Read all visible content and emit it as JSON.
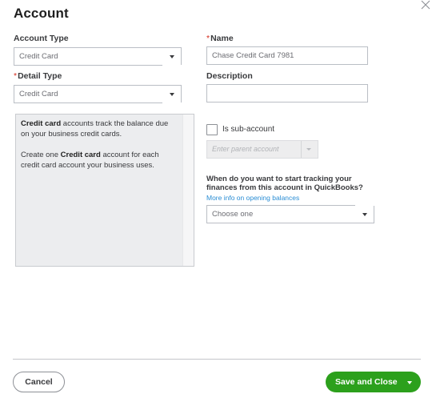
{
  "dialog": {
    "title": "Account",
    "close_icon": "close-icon"
  },
  "form": {
    "account_type": {
      "label": "Account Type",
      "value": "Credit Card"
    },
    "detail_type": {
      "required_marker": "*",
      "label": "Detail Type",
      "value": "Credit Card"
    },
    "name": {
      "required_marker": "*",
      "label": "Name",
      "value": "Chase Credit Card 7981"
    },
    "description": {
      "label": "Description",
      "value": ""
    },
    "sub_account": {
      "label": "Is sub-account",
      "checked": false,
      "parent_placeholder": "Enter parent account"
    },
    "opening_balance": {
      "question": "When do you want to start tracking your finances from this account in QuickBooks?",
      "link": "More info on opening balances",
      "value": "Choose one"
    }
  },
  "help": {
    "p1_bold": "Credit card",
    "p1_rest": " accounts track the balance due on your business credit cards.",
    "p2_start": "Create one ",
    "p2_bold": "Credit card",
    "p2_rest": " account for each credit card account your business uses."
  },
  "footer": {
    "cancel_label": "Cancel",
    "save_label": "Save and Close"
  },
  "colors": {
    "primary_green": "#2ca01c",
    "required_red": "#d52b1e",
    "link_blue": "#2a8dd4"
  }
}
